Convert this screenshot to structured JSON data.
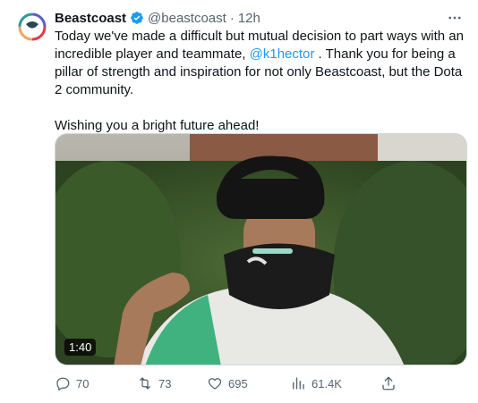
{
  "tweet": {
    "author": {
      "name": "Beastcoast",
      "handle": "@beastcoast",
      "separator": "·",
      "time": "12h",
      "avatar": "beastcoast-logo",
      "verified_icon": "verified-badge-icon"
    },
    "text": {
      "part1": "Today we've made a difficult but mutual decision to part ways with an incredible player and teammate, ",
      "mention": "@k1hector",
      "part2": " . Thank you for being a pillar of strength and inspiration for not only Beastcoast, but the Dota 2 community.",
      "closing": "Wishing you a bright future ahead!"
    },
    "media": {
      "type": "video",
      "duration": "1:40"
    },
    "actions": {
      "replies": "70",
      "reposts": "73",
      "likes": "695",
      "views": "61.4K"
    },
    "colors": {
      "accent": "#1d9bf0",
      "text": "#0f1419",
      "muted": "#536471"
    }
  }
}
